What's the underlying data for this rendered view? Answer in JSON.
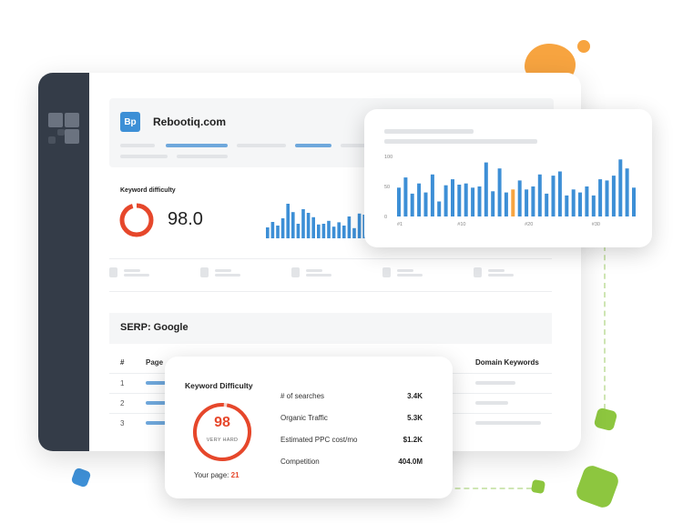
{
  "site": {
    "badge": "Bp",
    "domain": "Rebootiq.com"
  },
  "keyword_difficulty": {
    "label": "Keyword difficulty",
    "value": "98.0"
  },
  "serp": {
    "title": "SERP: Google"
  },
  "table": {
    "headers": {
      "index": "#",
      "page": "Page",
      "domain_keywords": "Domain Keywords"
    },
    "rows": [
      "1",
      "2",
      "3"
    ]
  },
  "kd_card": {
    "title": "Keyword Difficulty",
    "score": "98",
    "level": "VERY HARD",
    "your_page_label": "Your page:",
    "your_page_value": "21",
    "score_fraction": 0.98,
    "metrics": [
      {
        "label": "# of searches",
        "value": "3.4K"
      },
      {
        "label": "Organic Traffic",
        "value": "5.3K"
      },
      {
        "label": "Estimated PPC cost/mo",
        "value": "$1.2K"
      },
      {
        "label": "Competition",
        "value": "404.0M"
      }
    ]
  },
  "mini_bars": {
    "values": [
      30,
      45,
      35,
      55,
      95,
      72,
      40,
      80,
      70,
      58,
      38,
      40,
      48,
      32,
      44,
      35,
      60,
      28,
      68,
      65
    ]
  },
  "chart_data": {
    "type": "bar",
    "x": [
      1,
      2,
      3,
      4,
      5,
      6,
      7,
      8,
      9,
      10,
      11,
      12,
      13,
      14,
      15,
      16,
      17,
      18,
      19,
      20,
      21,
      22,
      23,
      24,
      25,
      26,
      27,
      28,
      29,
      30,
      31,
      32,
      33
    ],
    "values": [
      48,
      65,
      38,
      55,
      40,
      70,
      25,
      52,
      62,
      53,
      55,
      48,
      50,
      90,
      42,
      80,
      40,
      45,
      60,
      45,
      50,
      70,
      38,
      68,
      75,
      35,
      45,
      40,
      50,
      35,
      62,
      60,
      68,
      95,
      80,
      48
    ],
    "highlight_index": 17,
    "ylim": [
      0,
      100
    ],
    "yticks": [
      "100",
      "50",
      "0"
    ],
    "xticks": [
      "#1",
      "#10",
      "#20",
      "#30"
    ],
    "colors": {
      "bar": "#3d8fd6",
      "highlight": "#f7a440"
    }
  },
  "colors": {
    "accent": "#3d8fd6",
    "danger": "#e6472b",
    "sidebar": "#343c48"
  }
}
